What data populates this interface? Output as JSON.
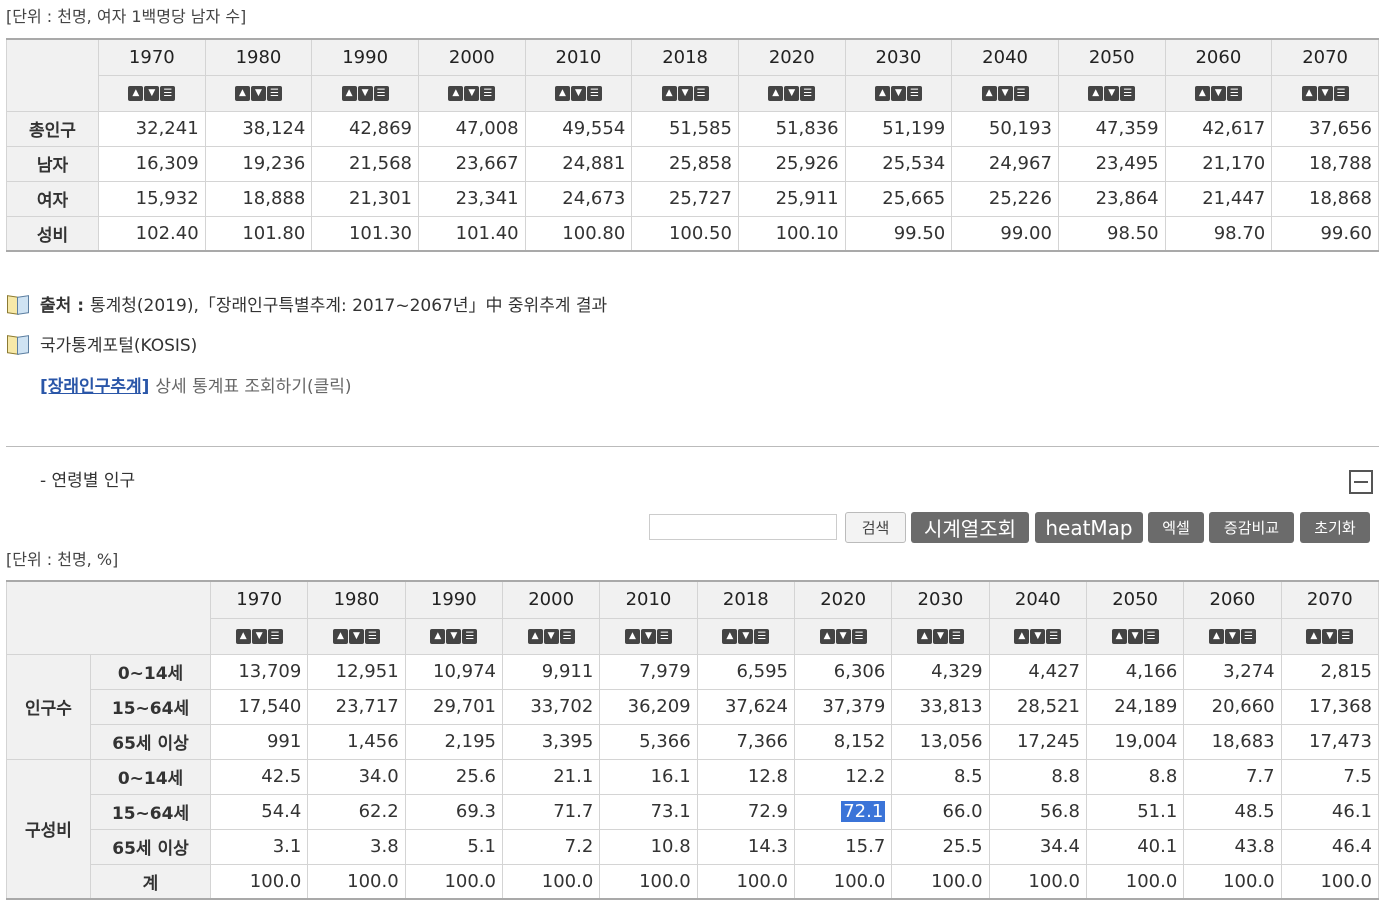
{
  "table1": {
    "unit": "[단위 : 천명, 여자 1백명당 남자 수]",
    "years": [
      "1970",
      "1980",
      "1990",
      "2000",
      "2010",
      "2018",
      "2020",
      "2030",
      "2040",
      "2050",
      "2060",
      "2070"
    ],
    "rows": [
      {
        "label": "총인구",
        "values": [
          "32,241",
          "38,124",
          "42,869",
          "47,008",
          "49,554",
          "51,585",
          "51,836",
          "51,199",
          "50,193",
          "47,359",
          "42,617",
          "37,656"
        ]
      },
      {
        "label": "남자",
        "values": [
          "16,309",
          "19,236",
          "21,568",
          "23,667",
          "24,881",
          "25,858",
          "25,926",
          "25,534",
          "24,967",
          "23,495",
          "21,170",
          "18,788"
        ]
      },
      {
        "label": "여자",
        "values": [
          "15,932",
          "18,888",
          "21,301",
          "23,341",
          "24,673",
          "25,727",
          "25,911",
          "25,665",
          "25,226",
          "23,864",
          "21,447",
          "18,868"
        ]
      },
      {
        "label": "성비",
        "values": [
          "102.40",
          "101.80",
          "101.30",
          "101.40",
          "100.80",
          "100.50",
          "100.10",
          "99.50",
          "99.00",
          "98.50",
          "98.70",
          "99.60"
        ]
      }
    ]
  },
  "source": {
    "label": "출처 :",
    "text": "통계청(2019),「장래인구특별추계: 2017~2067년」中 중위추계 결과",
    "kosis_title": "국가통계포털(KOSIS)",
    "link_label": "[장래인구추계]",
    "link_desc": "상세 통계표 조회하기(클릭)"
  },
  "section2": {
    "title": "- 연령별 인구",
    "search_button": "검색",
    "buttons": [
      "시계열조회",
      "heatMap",
      "엑셀",
      "증감비교",
      "초기화"
    ],
    "unit": "[단위 : 천명, %]"
  },
  "table2": {
    "years": [
      "1970",
      "1980",
      "1990",
      "2000",
      "2010",
      "2018",
      "2020",
      "2030",
      "2040",
      "2050",
      "2060",
      "2070"
    ],
    "groups": [
      {
        "label": "인구수",
        "rows": [
          {
            "label": "0~14세",
            "values": [
              "13,709",
              "12,951",
              "10,974",
              "9,911",
              "7,979",
              "6,595",
              "6,306",
              "4,329",
              "4,427",
              "4,166",
              "3,274",
              "2,815"
            ]
          },
          {
            "label": "15~64세",
            "values": [
              "17,540",
              "23,717",
              "29,701",
              "33,702",
              "36,209",
              "37,624",
              "37,379",
              "33,813",
              "28,521",
              "24,189",
              "20,660",
              "17,368"
            ]
          },
          {
            "label": "65세 이상",
            "values": [
              "991",
              "1,456",
              "2,195",
              "3,395",
              "5,366",
              "7,366",
              "8,152",
              "13,056",
              "17,245",
              "19,004",
              "18,683",
              "17,473"
            ]
          }
        ]
      },
      {
        "label": "구성비",
        "rows": [
          {
            "label": "0~14세",
            "values": [
              "42.5",
              "34.0",
              "25.6",
              "21.1",
              "16.1",
              "12.8",
              "12.2",
              "8.5",
              "8.8",
              "8.8",
              "7.7",
              "7.5"
            ]
          },
          {
            "label": "15~64세",
            "values": [
              "54.4",
              "62.2",
              "69.3",
              "71.7",
              "73.1",
              "72.9",
              "72.1",
              "66.0",
              "56.8",
              "51.1",
              "48.5",
              "46.1"
            ]
          },
          {
            "label": "65세 이상",
            "values": [
              "3.1",
              "3.8",
              "5.1",
              "7.2",
              "10.8",
              "14.3",
              "15.7",
              "25.5",
              "34.4",
              "40.1",
              "43.8",
              "46.4"
            ]
          },
          {
            "label": "계",
            "values": [
              "100.0",
              "100.0",
              "100.0",
              "100.0",
              "100.0",
              "100.0",
              "100.0",
              "100.0",
              "100.0",
              "100.0",
              "100.0",
              "100.0"
            ]
          }
        ]
      }
    ]
  }
}
